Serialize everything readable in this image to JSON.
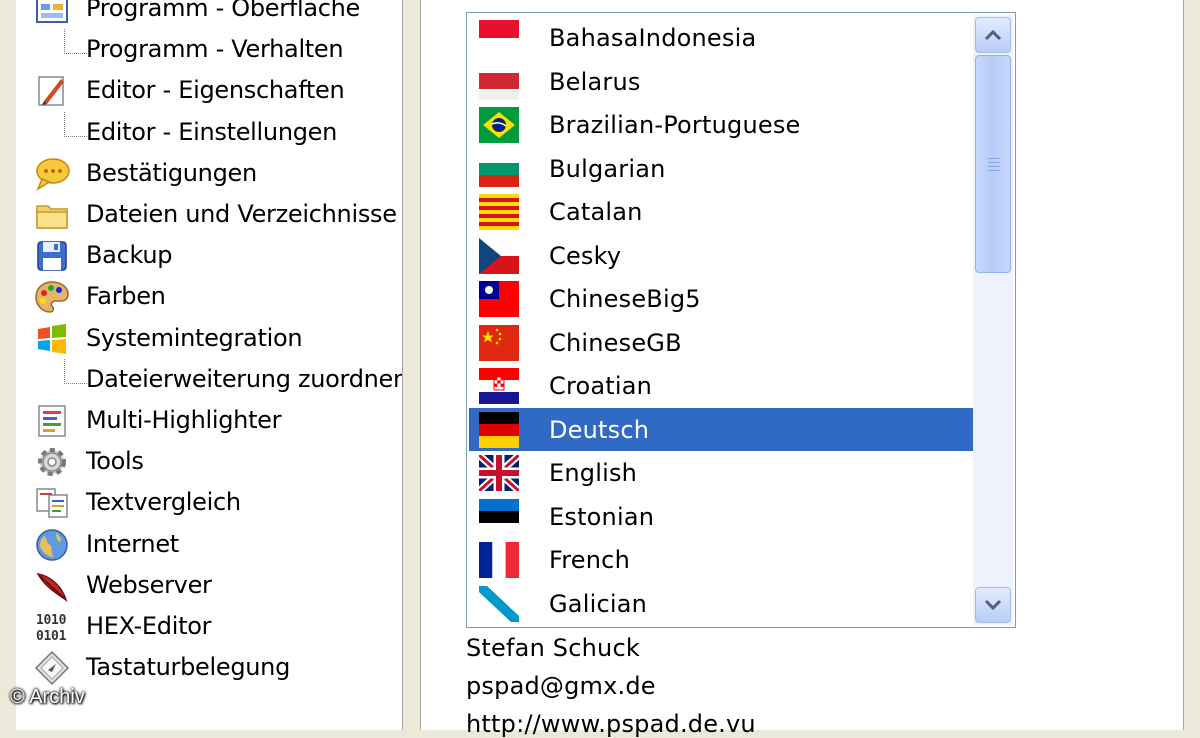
{
  "tree": {
    "items": [
      {
        "label": "Programm - Oberfläche",
        "icon": "window-icon"
      },
      {
        "label": "Programm - Verhalten",
        "icon": ""
      },
      {
        "label": "Editor - Eigenschaften",
        "icon": "pencil-icon"
      },
      {
        "label": "Editor - Einstellungen",
        "icon": ""
      },
      {
        "label": "Bestätigungen",
        "icon": "speech-bubble-icon"
      },
      {
        "label": "Dateien und Verzeichnisse",
        "icon": "folder-icon"
      },
      {
        "label": "Backup",
        "icon": "floppy-disk-icon"
      },
      {
        "label": "Farben",
        "icon": "palette-icon"
      },
      {
        "label": "Systemintegration",
        "icon": "windows-logo-icon"
      },
      {
        "label": "Dateierweiterung zuordnen",
        "icon": ""
      },
      {
        "label": "Multi-Highlighter",
        "icon": "highlighter-document-icon"
      },
      {
        "label": "Tools",
        "icon": "gear-icon"
      },
      {
        "label": "Textvergleich",
        "icon": "compare-documents-icon"
      },
      {
        "label": "Internet",
        "icon": "globe-icon"
      },
      {
        "label": "Webserver",
        "icon": "feather-icon"
      },
      {
        "label": "HEX-Editor",
        "icon": "binary-icon"
      },
      {
        "label": "Tastaturbelegung",
        "icon": "keyboard-key-icon"
      }
    ]
  },
  "languages": {
    "selected": "Deutsch",
    "items": [
      {
        "name": "BahasaIndonesia",
        "flag": "indonesia"
      },
      {
        "name": "Belarus",
        "flag": "belarus"
      },
      {
        "name": "Brazilian-Portuguese",
        "flag": "brazil"
      },
      {
        "name": "Bulgarian",
        "flag": "bulgaria"
      },
      {
        "name": "Catalan",
        "flag": "catalonia"
      },
      {
        "name": "Cesky",
        "flag": "czech"
      },
      {
        "name": "ChineseBig5",
        "flag": "taiwan"
      },
      {
        "name": "ChineseGB",
        "flag": "china"
      },
      {
        "name": "Croatian",
        "flag": "croatia"
      },
      {
        "name": "Deutsch",
        "flag": "germany"
      },
      {
        "name": "English",
        "flag": "uk"
      },
      {
        "name": "Estonian",
        "flag": "estonia"
      },
      {
        "name": "French",
        "flag": "france"
      },
      {
        "name": "Galician",
        "flag": "galicia"
      }
    ]
  },
  "info": {
    "author": "Stefan Schuck",
    "email": "pspad@gmx.de",
    "url": "http://www.pspad.de.vu"
  },
  "watermark": "© Archiv",
  "colors": {
    "selection": "#316ac5",
    "list_border": "#7f9db9",
    "window_bg": "#ece9d8"
  }
}
